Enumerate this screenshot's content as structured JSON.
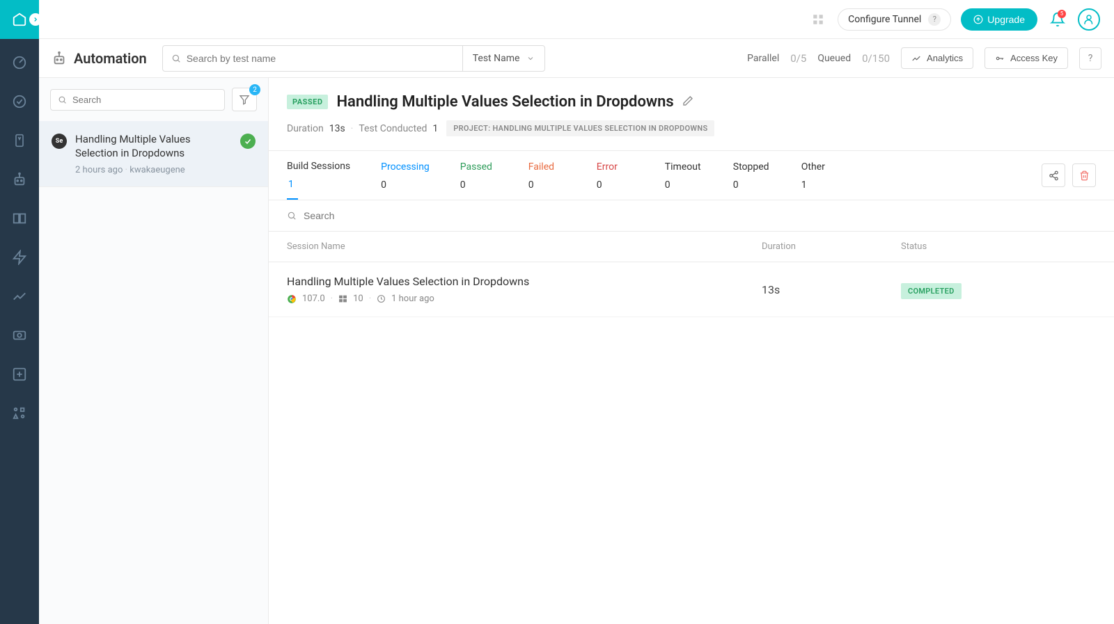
{
  "header": {
    "configure_tunnel": "Configure Tunnel",
    "upgrade": "Upgrade",
    "notification_count": "5"
  },
  "page": {
    "title": "Automation",
    "search_placeholder": "Search by test name",
    "test_name_select": "Test Name",
    "parallel_label": "Parallel",
    "parallel_val": "0/5",
    "queued_label": "Queued",
    "queued_val": "0/150",
    "analytics": "Analytics",
    "access_key": "Access Key",
    "help": "?"
  },
  "list": {
    "search_placeholder": "Search",
    "filter_count": "2",
    "items": [
      {
        "title": "Handling Multiple Values Selection in Dropdowns",
        "time": "2 hours ago",
        "author": "kwakaeugene"
      }
    ]
  },
  "detail": {
    "status_badge": "PASSED",
    "title": "Handling Multiple Values Selection in Dropdowns",
    "duration_label": "Duration",
    "duration_val": "13s",
    "conducted_label": "Test Conducted",
    "conducted_val": "1",
    "project_label": "PROJECT: HANDLING MULTIPLE VALUES SELECTION IN DROPDOWNS"
  },
  "tabs": {
    "build_sessions": {
      "label": "Build Sessions",
      "count": "1"
    },
    "processing": {
      "label": "Processing",
      "count": "0"
    },
    "passed": {
      "label": "Passed",
      "count": "0"
    },
    "failed": {
      "label": "Failed",
      "count": "0"
    },
    "error": {
      "label": "Error",
      "count": "0"
    },
    "timeout": {
      "label": "Timeout",
      "count": "0"
    },
    "stopped": {
      "label": "Stopped",
      "count": "0"
    },
    "other": {
      "label": "Other",
      "count": "1"
    }
  },
  "inner_search": {
    "placeholder": "Search"
  },
  "session_table": {
    "col_name": "Session Name",
    "col_duration": "Duration",
    "col_status": "Status",
    "rows": [
      {
        "name": "Handling Multiple Values Selection in Dropdowns",
        "browser_version": "107.0",
        "os_version": "10",
        "time": "1 hour ago",
        "duration": "13s",
        "status": "COMPLETED"
      }
    ]
  }
}
